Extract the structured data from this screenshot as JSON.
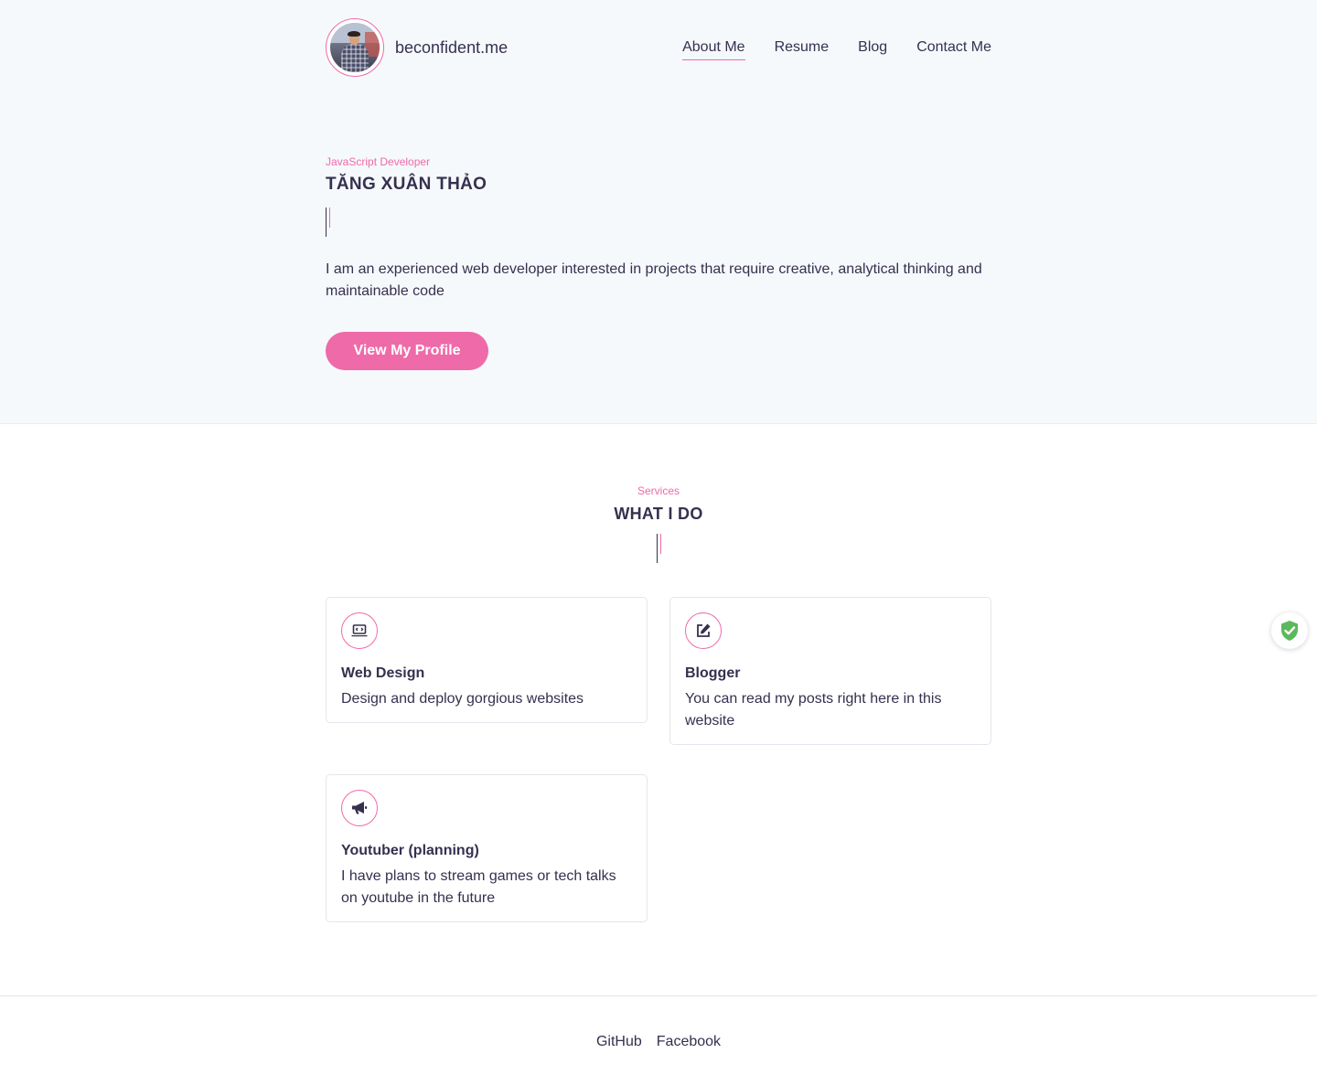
{
  "brand": {
    "name": "beconfident.me"
  },
  "nav": {
    "items": [
      {
        "label": "About Me",
        "active": true
      },
      {
        "label": "Resume",
        "active": false
      },
      {
        "label": "Blog",
        "active": false
      },
      {
        "label": "Contact Me",
        "active": false
      }
    ]
  },
  "hero": {
    "role": "JavaScript Developer",
    "name": "TĂNG XUÂN THẢO",
    "bio": "I am an experienced web developer interested in projects that require creative, analytical thinking and maintainable code",
    "cta_label": "View My Profile"
  },
  "services": {
    "eyebrow": "Services",
    "title": "WHAT I DO",
    "items": [
      {
        "icon": "laptop-code-icon",
        "title": "Web Design",
        "desc": "Design and deploy gorgious websites"
      },
      {
        "icon": "edit-icon",
        "title": "Blogger",
        "desc": "You can read my posts right here in this website"
      },
      {
        "icon": "megaphone-icon",
        "title": "Youtuber (planning)",
        "desc": "I have plans to stream games or tech talks on youtube in the future"
      }
    ]
  },
  "footer": {
    "links": [
      {
        "label": "GitHub"
      },
      {
        "label": "Facebook"
      }
    ]
  },
  "colors": {
    "accent": "#ef6aa8",
    "text": "#36304f",
    "hero_bg": "#f6f9fc",
    "shield": "#5cb85c"
  },
  "badge": {
    "icon": "shield-check-icon"
  }
}
